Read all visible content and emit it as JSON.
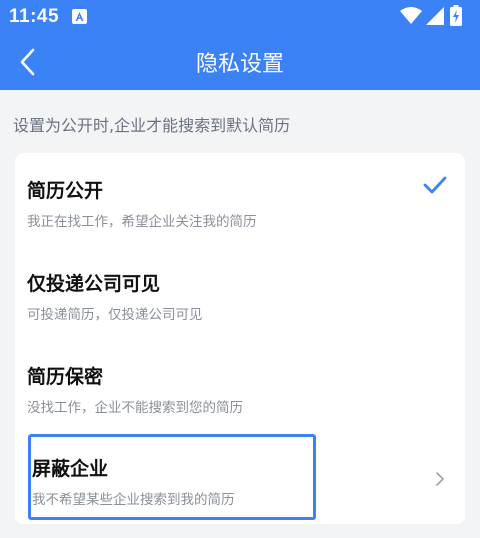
{
  "status_bar": {
    "time": "11:45",
    "notification_icon": "a-square-icon",
    "icons": [
      "wifi-icon",
      "signal-icon",
      "battery-charging-icon"
    ]
  },
  "header": {
    "title": "隐私设置",
    "back_icon": "back-chevron-icon",
    "background_color": "#3b82f6"
  },
  "hint": "设置为公开时,企业才能搜索到默认简历",
  "options": [
    {
      "title": "简历公开",
      "desc": "我正在找工作，希望企业关注我的简历",
      "selected": true
    },
    {
      "title": "仅投递公司可见",
      "desc": "可投递简历，仅投递公司可见",
      "selected": false
    },
    {
      "title": "简历保密",
      "desc": "没找工作，企业不能搜索到您的简历",
      "selected": false
    },
    {
      "title": "屏蔽企业",
      "desc": "我不希望某些企业搜索到我的简历",
      "selected": false,
      "has_chevron": true
    }
  ],
  "colors": {
    "accent": "#3b82f6",
    "page_bg": "#f3f4f6"
  }
}
